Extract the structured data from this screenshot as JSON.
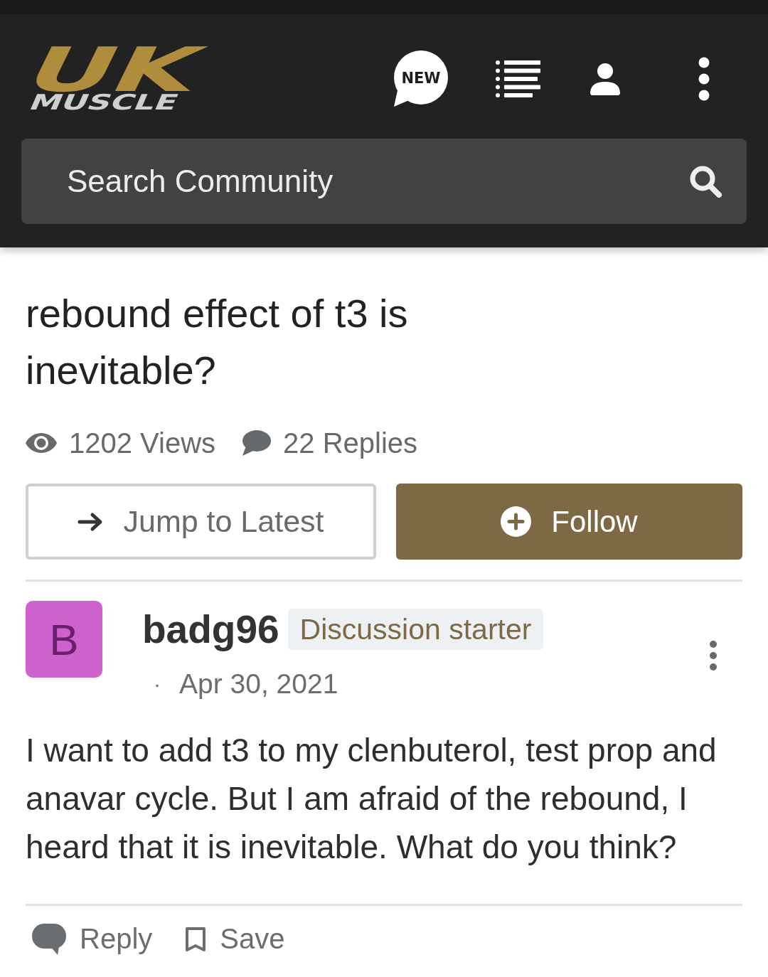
{
  "header": {
    "logo": {
      "top": "UK",
      "bottom": "MUSCLE"
    },
    "new_badge": "NEW"
  },
  "search": {
    "placeholder": "Search Community"
  },
  "thread": {
    "title": "rebound effect of t3 is inevitable?",
    "stats": [
      {
        "kind": "views",
        "label": "1202 Views"
      },
      {
        "kind": "replies",
        "label": "22 Replies"
      }
    ],
    "actions": [
      {
        "kind": "jump",
        "label": "Jump to Latest"
      },
      {
        "kind": "follow",
        "label": "Follow"
      }
    ]
  },
  "post": {
    "avatar": "B",
    "author": "badg96",
    "badge": "Discussion starter",
    "separator": "·",
    "date": "Apr 30, 2021",
    "body": "I want to add t3 to my clenbuterol, test prop and anavar cycle. But I am afraid of the rebound, I heard that it is inevitable. What do you think?",
    "actions": [
      {
        "kind": "reply",
        "label": "Reply"
      },
      {
        "kind": "save",
        "label": "Save"
      }
    ]
  }
}
